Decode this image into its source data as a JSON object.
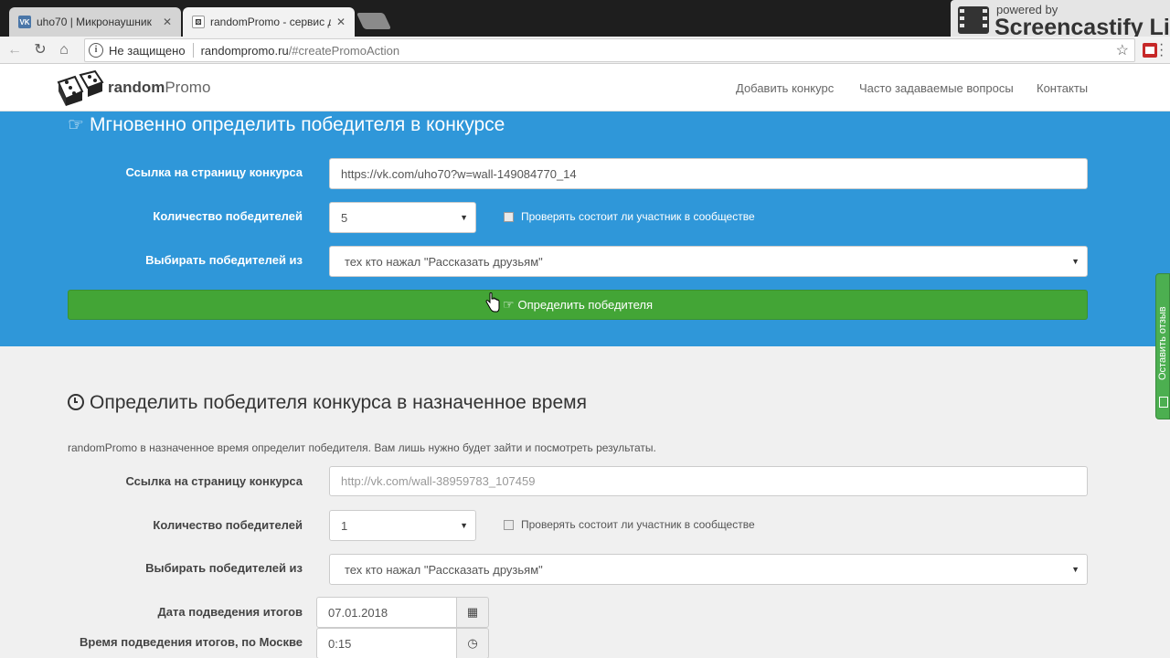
{
  "browser": {
    "tabs": [
      {
        "title": "uho70 | Микронаушник",
        "favicon": "vk-icon",
        "active": false
      },
      {
        "title": "randomPromo - сервис д",
        "favicon": "dice-icon",
        "active": true
      }
    ],
    "address": {
      "security_label": "Не защищено",
      "host": "randompromo.ru",
      "path": "/#createPromoAction"
    },
    "overlay": {
      "powered_by": "powered by",
      "name": "Screencastify Lit"
    }
  },
  "site": {
    "logo": {
      "bold": "random",
      "normal": "Promo"
    },
    "nav": [
      "Добавить конкурс",
      "Часто задаваемые вопросы",
      "Контакты"
    ]
  },
  "instant": {
    "title": "Мгновенно определить победителя в конкурсе",
    "link_label": "Ссылка на страницу конкурса",
    "link_value": "https://vk.com/uho70?w=wall-149084770_14",
    "winners_label": "Количество победителей",
    "winners_value": "5",
    "check_label": "Проверять состоит ли участник в сообществе",
    "from_label": "Выбирать победителей из",
    "from_value": "тех кто нажал \"Рассказать друзьям\"",
    "button_label": "Определить победителя"
  },
  "scheduled": {
    "title": "Определить победителя конкурса в назначенное время",
    "description": "randomPromo в назначенное время определит победителя. Вам лишь нужно будет зайти и посмотреть результаты.",
    "link_label": "Ссылка на страницу конкурса",
    "link_placeholder": "http://vk.com/wall-38959783_107459",
    "winners_label": "Количество победителей",
    "winners_value": "1",
    "check_label": "Проверять состоит ли участник в сообществе",
    "from_label": "Выбирать победителей из",
    "from_value": "тех кто нажал \"Рассказать друзьям\"",
    "date_label": "Дата подведения итогов",
    "date_value": "07.01.2018",
    "time_label": "Время подведения итогов, по Москве",
    "time_value": "0:15"
  },
  "feedback": {
    "label": "Оставить отзыв"
  },
  "colors": {
    "accent": "#2f97d9",
    "button": "#43a536",
    "page_bg": "#f0f0f0"
  }
}
